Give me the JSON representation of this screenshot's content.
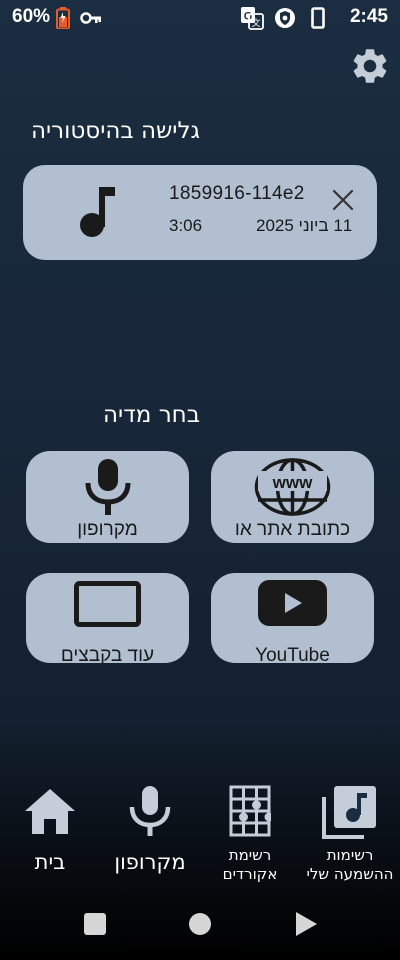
{
  "status_bar": {
    "battery_percent": "60%",
    "time": "2:45",
    "icons": [
      "battery-icon",
      "vpn-key-icon",
      "translate-icon",
      "vpn-shield-icon",
      "phone-outline-icon"
    ]
  },
  "header": {
    "settings_icon": "gear-icon"
  },
  "history": {
    "title": "גלישה בהיסטוריה",
    "items": [
      {
        "name": "1859916-114e2",
        "date": "11 ביוני 2025",
        "duration": "3:06",
        "icon": "music-note-icon"
      }
    ]
  },
  "media": {
    "title": "בחר מדיה",
    "tiles": [
      {
        "id": "website",
        "label": "כתובת אתר או",
        "icon": "www-globe-icon"
      },
      {
        "id": "microphone",
        "label": "מקרופון",
        "icon": "microphone-icon"
      },
      {
        "id": "youtube",
        "label": "YouTube",
        "icon": "youtube-icon"
      },
      {
        "id": "device",
        "label": "עוד בקבצים",
        "icon": "device-frame-icon"
      }
    ]
  },
  "bottom_nav": {
    "items": [
      {
        "label": "בית",
        "icon": "home-icon"
      },
      {
        "label": "מקרופון",
        "icon": "microphone-icon"
      },
      {
        "label_line1": "רשימת",
        "label_line2": "אקורדים",
        "icon": "chord-grid-icon"
      },
      {
        "label_line1": "רשימות",
        "label_line2": "ההשמעה שלי",
        "icon": "playlist-icon"
      }
    ]
  },
  "colors": {
    "background_top": "#1b2d40",
    "background_bottom": "#13202f",
    "card": "#b1bfd0",
    "icon_dark": "#1a1a1a",
    "nav_icon": "#c4cdd8",
    "battery_accent": "#e85c2a"
  }
}
